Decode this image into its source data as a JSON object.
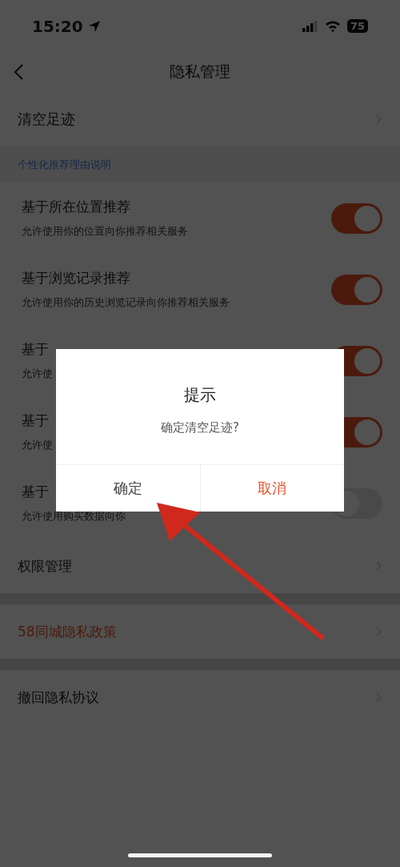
{
  "status_bar": {
    "time": "15:20",
    "battery": "75"
  },
  "nav": {
    "title": "隐私管理"
  },
  "clear_row": {
    "label": "清空足迹"
  },
  "section_header": "个性化推荐理由说明",
  "recommend_items": [
    {
      "title": "基于所在位置推荐",
      "subtitle": "允许使用你的位置向你推荐相关服务",
      "on": true
    },
    {
      "title": "基于浏览记录推荐",
      "subtitle": "允许使用你的历史浏览记录向你推荐相关服务",
      "on": true
    },
    {
      "title": "基于",
      "subtitle": "允许使",
      "on": true
    },
    {
      "title": "基于",
      "subtitle": "允许使",
      "on": true
    },
    {
      "title": "基于",
      "subtitle": "允许使用购买数据向你",
      "on": false
    }
  ],
  "links": [
    {
      "label": "权限管理",
      "kind": "normal"
    },
    {
      "label": "58同城隐私政策",
      "kind": "highlight"
    },
    {
      "label": "撤回隐私协议",
      "kind": "normal"
    }
  ],
  "dialog": {
    "title": "提示",
    "message": "确定清空足迹?",
    "buttons": [
      {
        "label": "确定",
        "kind": "confirm"
      },
      {
        "label": "取消",
        "kind": "cancel"
      }
    ]
  }
}
